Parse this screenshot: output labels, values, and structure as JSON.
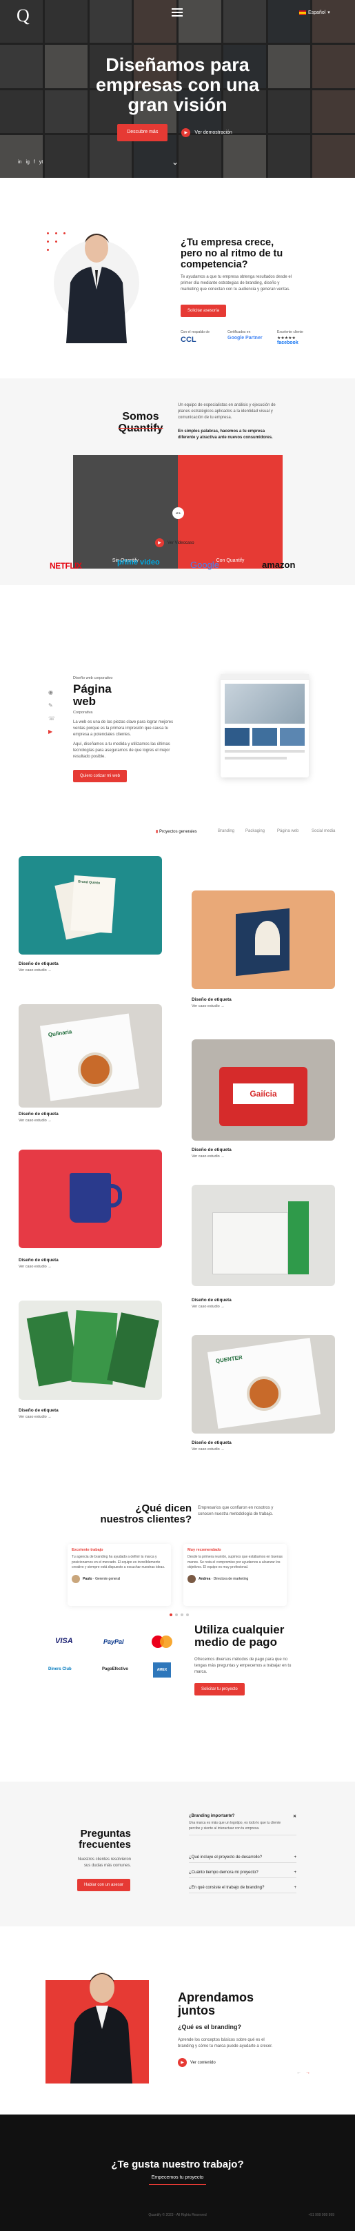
{
  "header": {
    "logo": "Q",
    "lang_label": "Español",
    "menu_icon": "hamburger-icon"
  },
  "hero": {
    "title_line1": "Diseñamos para",
    "title_line2": "empresas con una",
    "title_line3": "gran visión",
    "cta_primary": "Descubre más",
    "cta_secondary": "Ver demostración",
    "socials": [
      "in",
      "ig",
      "f",
      "yt"
    ],
    "scroll_icon": "chevron-down-icon"
  },
  "growth": {
    "title": "¿Tu empresa crece, pero no al ritmo de tu competencia?",
    "body": "Te ayudamos a que tu empresa obtenga resultados desde el primer día mediante estrategias de branding, diseño y marketing que conectan con tu audiencia y generan ventas.",
    "cta": "Solicitar asesoría",
    "certs": [
      {
        "label": "Con el respaldo de",
        "name": "CCL"
      },
      {
        "label": "Certificados en",
        "name": "Google Partner"
      },
      {
        "label": "Excelente cliente",
        "name": "facebook"
      }
    ],
    "cert_stars": "★★★★★"
  },
  "about": {
    "title_line1": "Somos",
    "title_line2": "Quantify",
    "body1": "Un equipo de especialistas en análisis y ejecución de planes estratégicos aplicados a la identidad visual y comunicación de tu empresa.",
    "body2": "En simples palabras, hacemos a tu empresa diferente y atractiva ante nuevos consumidores.",
    "compare_left": "Sin Quantify",
    "compare_right": "Con Quantify",
    "handle_text": "◂ ▸",
    "video_link": "Ver Videocaso",
    "brands": [
      "NETFLIX",
      "prime video",
      "Google",
      "amazon"
    ]
  },
  "web": {
    "eyebrow": "Diseño web corporativo",
    "title_line1": "Página",
    "title_line2": "web",
    "sub": "Corporativa",
    "body1": "La web es una de las piezas clave para lograr mejores ventas porque es la primera impresión que causa tu empresa a potenciales clientes.",
    "body2": "Aquí, diseñamos a tu medida y utilizamos las últimas tecnologías para asegurarnos de que logres el mejor resultado posible.",
    "cta": "Quiero cotizar mi web",
    "icons": [
      "location-icon",
      "pencil-icon",
      "phone-icon",
      "youtube-icon"
    ]
  },
  "portfolio": {
    "filters": [
      "Proyectos generales",
      "Branding",
      "Packaging",
      "Página web",
      "Social media"
    ],
    "items": [
      {
        "title": "Diseño de etiqueta",
        "link": "Ver caso estudio →"
      },
      {
        "title": "Diseño de etiqueta",
        "link": "Ver caso estudio →"
      },
      {
        "title": "Diseño de etiqueta",
        "link": "Ver caso estudio →"
      },
      {
        "title": "Diseño de etiqueta",
        "link": "Ver caso estudio →"
      },
      {
        "title": "Diseño de etiqueta",
        "link": "Ver caso estudio →"
      },
      {
        "title": "Diseño de etiqueta",
        "link": "Ver caso estudio →"
      },
      {
        "title": "Diseño de etiqueta",
        "link": "Ver caso estudio →"
      },
      {
        "title": "Diseño de etiqueta",
        "link": "Ver caso estudio →"
      }
    ],
    "mockup_texts": [
      "Brand Quinto",
      "Gaiícia",
      "Qulinaria",
      "QUENTER"
    ]
  },
  "testimonials": {
    "title_line1": "¿Qué dicen",
    "title_line2": "nuestros clientes?",
    "intro": "Empresarios que confiaron en nosotros y conocen nuestra metodología de trabajo.",
    "items": [
      {
        "heading": "Excelente trabajo",
        "text": "Tu agencia de branding ha ayudado a definir la marca y posicionarnos en el mercado. El equipo es increíblemente creativo y siempre está dispuesto a escuchar nuestras ideas.",
        "name": "Paulo",
        "role": "Gerente general"
      },
      {
        "heading": "Muy recomendado",
        "text": "Desde la primera reunión, supimos que estábamos en buenas manos. Se nota el compromiso por ayudarnos a alcanzar los objetivos. El equipo es muy profesional.",
        "name": "Andrea",
        "role": "Directora de marketing"
      }
    ]
  },
  "payment": {
    "title_line1": "Utiliza cualquier",
    "title_line2": "medio de pago",
    "body": "Ofrecemos diversos métodos de pago para que no tengas más preguntas y empecemos a trabajar en tu marca.",
    "cta": "Solicitar tu proyecto",
    "methods": [
      "VISA",
      "PayPal",
      "Mastercard",
      "Diners Club",
      "PagoEfectivo",
      "AMEX"
    ]
  },
  "faq": {
    "title_line1": "Preguntas",
    "title_line2": "frecuentes",
    "body": "Nuestros clientes resolvieron sus dudas más comunes.",
    "cta": "Hablar con un asesor",
    "items": [
      {
        "q": "¿Branding importante?",
        "a": "Una marca es más que un logotipo, es todo lo que tu cliente percibe y siente al interactuar con tu empresa."
      },
      {
        "q": "¿Qué incluye el proyecto de desarrollo?"
      },
      {
        "q": "¿Cuánto tiempo demora mi proyecto?"
      },
      {
        "q": "¿En qué consiste el trabajo de branding?"
      }
    ]
  },
  "learn": {
    "title_line1": "Aprendamos",
    "title_line2": "juntos",
    "question": "¿Qué es el branding?",
    "body": "Aprende los conceptos básicos sobre qué es el branding y cómo tu marca puede ayudarte a crecer.",
    "link": "Ver contenido"
  },
  "footer": {
    "title": "¿Te gusta nuestro trabajo?",
    "cta": "Empecemos tu proyecto",
    "copyright": "Quantify © 2023 - All Rights Reserved",
    "phone": "+51 999 999 999"
  },
  "colors": {
    "accent": "#e63a34",
    "dark": "#111111"
  }
}
